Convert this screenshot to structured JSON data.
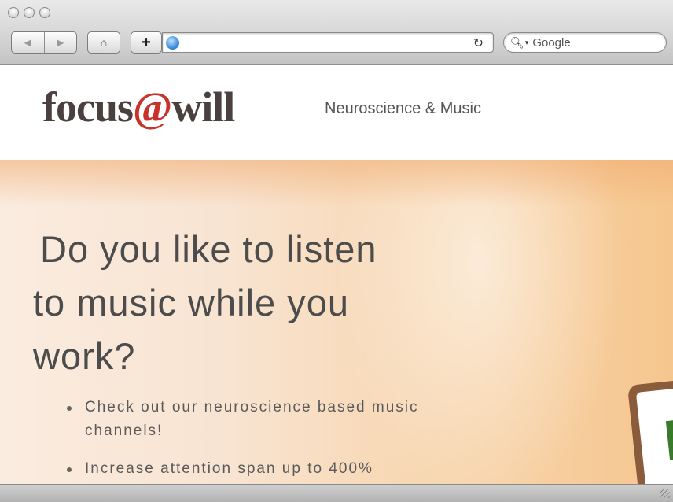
{
  "browser": {
    "nav": {
      "back_glyph": "◀",
      "forward_glyph": "▶"
    },
    "home_glyph": "⌂",
    "new_tab_glyph": "+",
    "address": {
      "value": "",
      "reload_glyph": "↻"
    },
    "search": {
      "placeholder": "Google"
    }
  },
  "site": {
    "logo": {
      "part1": "focus",
      "at": "@",
      "part2": "will"
    },
    "tagline": "Neuroscience & Music"
  },
  "hero": {
    "title_lines": [
      "Do you like to listen",
      "to music while you",
      "work?"
    ],
    "bullets": [
      "Check out our neuroscience based music channels!",
      "Increase attention span up to 400%"
    ]
  },
  "colors": {
    "logo_text": "#4a4040",
    "logo_at": "#c9322a",
    "hero_text": "#4c4c4c",
    "hero_accent": "#f5c082"
  }
}
